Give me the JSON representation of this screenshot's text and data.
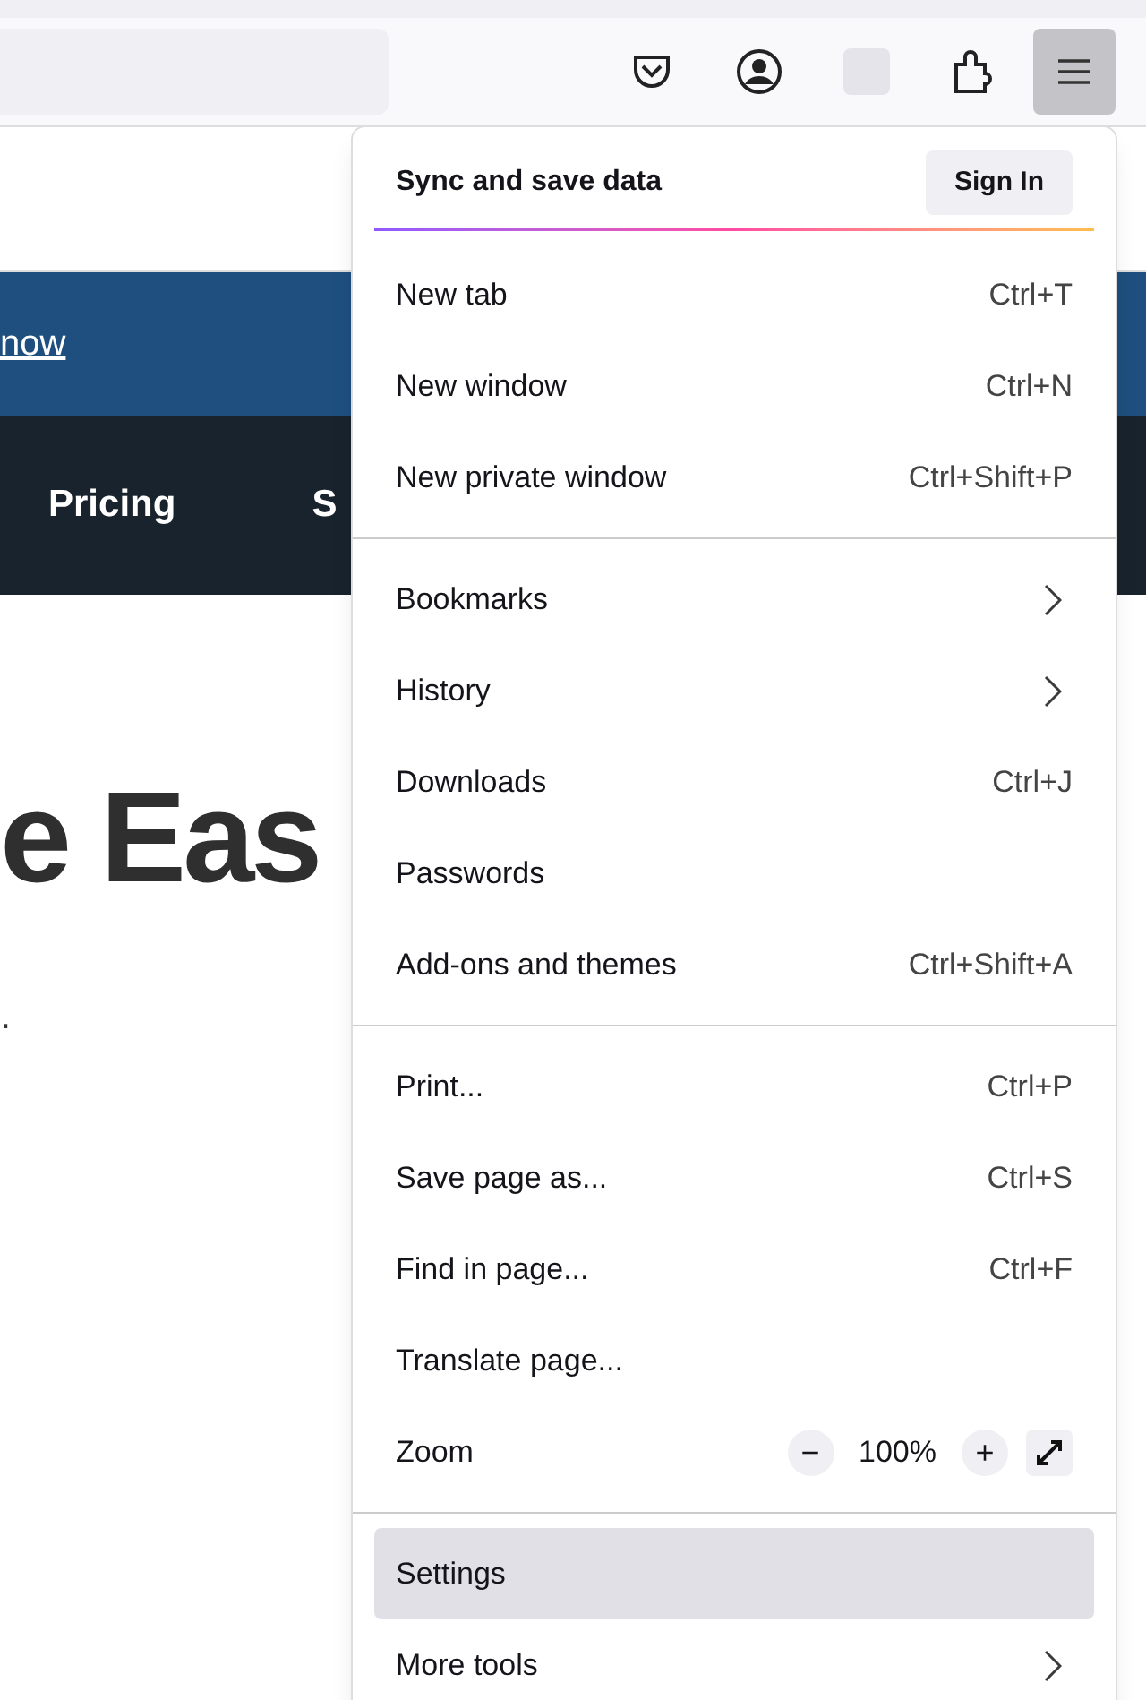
{
  "toolbar": {
    "menu_button": {
      "pressed": true
    }
  },
  "page": {
    "banner_link": "now",
    "nav_items": [
      "Pricing",
      "S"
    ],
    "heading": "e Eas",
    "subtitle": "."
  },
  "menu": {
    "header": {
      "title": "Sync and save data",
      "button": "Sign In"
    },
    "sections": [
      [
        {
          "kind": "shortcut",
          "label": "New tab",
          "shortcut": "Ctrl+T",
          "selected": false
        },
        {
          "kind": "shortcut",
          "label": "New window",
          "shortcut": "Ctrl+N",
          "selected": false
        },
        {
          "kind": "shortcut",
          "label": "New private window",
          "shortcut": "Ctrl+Shift+P",
          "selected": false
        }
      ],
      [
        {
          "kind": "submenu",
          "label": "Bookmarks",
          "selected": false
        },
        {
          "kind": "submenu",
          "label": "History",
          "selected": false
        },
        {
          "kind": "shortcut",
          "label": "Downloads",
          "shortcut": "Ctrl+J",
          "selected": false
        },
        {
          "kind": "plain",
          "label": "Passwords",
          "selected": false
        },
        {
          "kind": "shortcut",
          "label": "Add-ons and themes",
          "shortcut": "Ctrl+Shift+A",
          "selected": false
        }
      ],
      [
        {
          "kind": "shortcut",
          "label": "Print...",
          "shortcut": "Ctrl+P",
          "selected": false
        },
        {
          "kind": "shortcut",
          "label": "Save page as...",
          "shortcut": "Ctrl+S",
          "selected": false
        },
        {
          "kind": "shortcut",
          "label": "Find in page...",
          "shortcut": "Ctrl+F",
          "selected": false
        },
        {
          "kind": "plain",
          "label": "Translate page...",
          "selected": false
        },
        {
          "kind": "zoom",
          "label": "Zoom",
          "zoom_out": "−",
          "value": "100%",
          "zoom_in": "+",
          "selected": false
        }
      ],
      [
        {
          "kind": "plain",
          "label": "Settings",
          "selected": true
        },
        {
          "kind": "submenu",
          "label": "More tools",
          "selected": false
        }
      ]
    ]
  }
}
